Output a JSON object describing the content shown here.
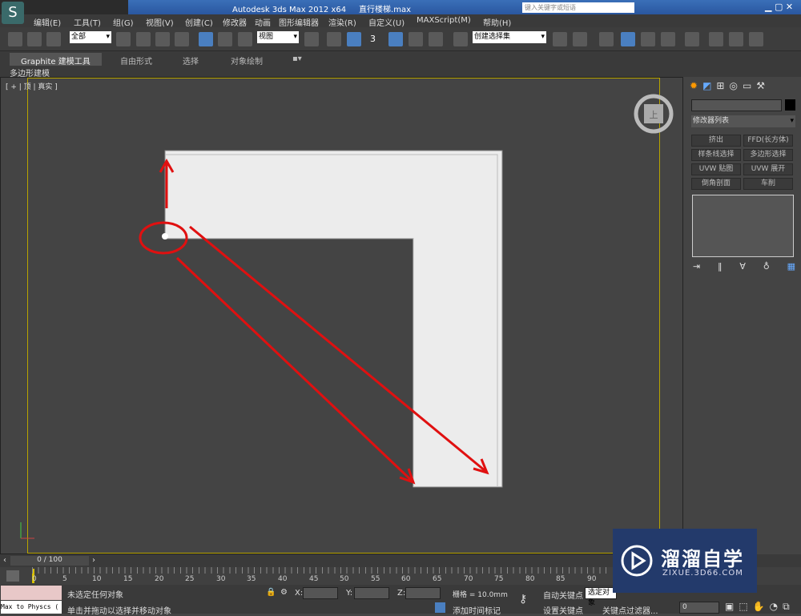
{
  "titlebar": {
    "app_title": "Autodesk 3ds Max  2012 x64",
    "file_name": "直行楼梯.max",
    "search_placeholder": "键入关键字或短语",
    "logo": "S"
  },
  "menu": [
    "编辑(E)",
    "工具(T)",
    "组(G)",
    "视图(V)",
    "创建(C)",
    "修改器",
    "动画",
    "图形编辑器",
    "渲染(R)",
    "自定义(U)",
    "MAXScript(M)",
    "帮助(H)"
  ],
  "toolbar": {
    "selection_filter": "全部",
    "reference_coord": "视图",
    "named_selection": "创建选择集",
    "snap_label": "3"
  },
  "ribbon": {
    "tabs": [
      "Graphite 建模工具",
      "自由形式",
      "选择",
      "对象绘制"
    ],
    "sub_label": "多边形建模"
  },
  "viewport": {
    "label": "[ + | 顶 | 真实 ]",
    "viewcube_label": "上",
    "accent": "#b8a400",
    "annotation_color": "#e01010"
  },
  "command_panel": {
    "modifier_list": "修改器列表",
    "buttons": [
      "挤出",
      "FFD(长方体)",
      "样条线选择",
      "多边形选择",
      "UVW 贴图",
      "UVW 展开",
      "倒角剖面",
      "车削"
    ]
  },
  "timeline": {
    "frame": "0 / 100",
    "ticks": [
      "0",
      "5",
      "10",
      "15",
      "20",
      "25",
      "30",
      "35",
      "40",
      "45",
      "50",
      "55",
      "60",
      "65",
      "70",
      "75",
      "80",
      "85",
      "90"
    ]
  },
  "status": {
    "script_listener": "Max to Physcs (",
    "selection_status": "未选定任何对象",
    "prompt": "单击并拖动以选择并移动对象",
    "x_label": "X:",
    "y_label": "Y:",
    "z_label": "Z:",
    "grid": "栅格 = 10.0mm",
    "add_time_tag": "添加时间标记",
    "auto_key": "自动关键点",
    "set_key": "设置关键点",
    "key_mode": "选定对象",
    "key_filters": "关键点过滤器...",
    "current_frame": "0"
  },
  "watermark": {
    "brand": "溜溜自学",
    "url": "ZIXUE.3D66.COM"
  }
}
